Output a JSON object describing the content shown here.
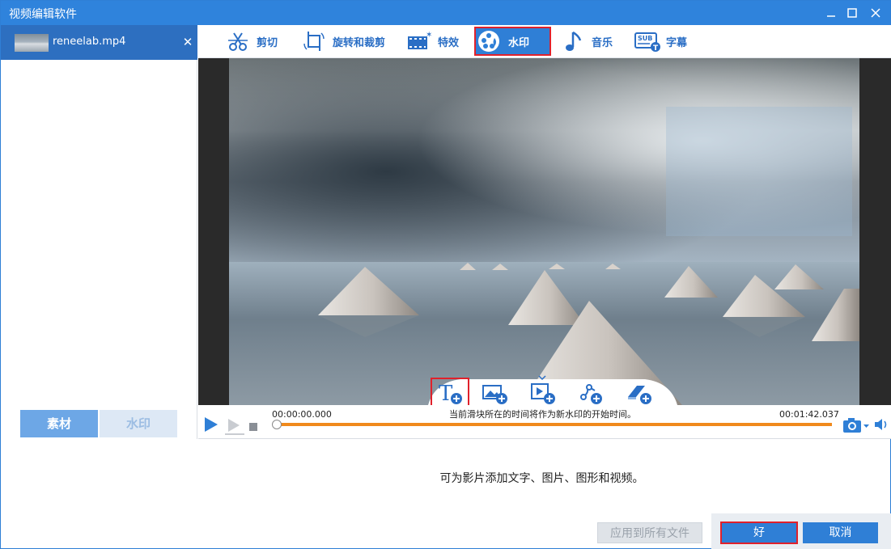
{
  "window": {
    "title": "视频编辑软件"
  },
  "file": {
    "name": "reneelab.mp4"
  },
  "left_tabs": [
    {
      "label": "素材",
      "active": true
    },
    {
      "label": "水印",
      "active": false
    }
  ],
  "toolbar": [
    {
      "label": "剪切",
      "icon": "scissors-icon"
    },
    {
      "label": "旋转和裁剪",
      "icon": "rotate-crop-icon"
    },
    {
      "label": "特效",
      "icon": "effects-film-icon"
    },
    {
      "label": "水印",
      "icon": "watermark-icon",
      "active": true
    },
    {
      "label": "音乐",
      "icon": "music-note-icon"
    },
    {
      "label": "字幕",
      "icon": "subtitle-icon"
    }
  ],
  "watermark_tools": [
    {
      "icon": "add-text-icon",
      "highlighted": true
    },
    {
      "icon": "add-image-icon"
    },
    {
      "icon": "add-video-icon"
    },
    {
      "icon": "add-shape-icon"
    },
    {
      "icon": "add-eraser-icon"
    }
  ],
  "playback": {
    "current_time": "00:00:00.000",
    "total_time": "00:01:42.037",
    "hint": "当前滑块所在的时间将作为新水印的开始时间。",
    "progress": 0
  },
  "description": "可为影片添加文字、图片、图形和视频。",
  "buttons": {
    "apply_all": "应用到所有文件",
    "ok": "好",
    "cancel": "取消"
  },
  "colors": {
    "accent": "#2f7fd6",
    "highlight_border": "#e0212b",
    "progress": "#f08a1c"
  }
}
